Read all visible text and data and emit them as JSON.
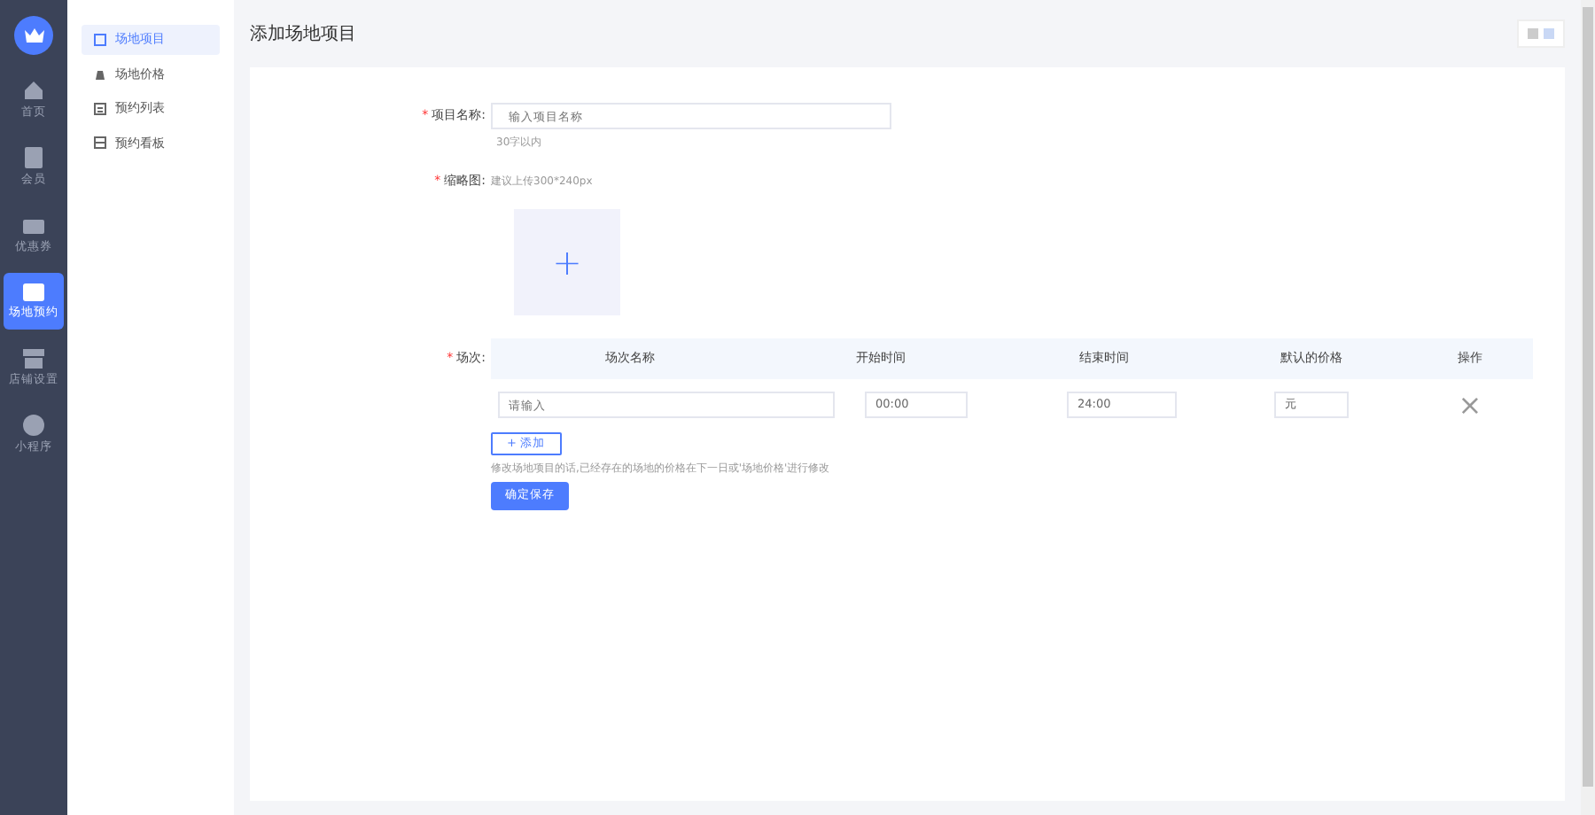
{
  "main_nav": [
    {
      "label": "首页",
      "selected": false
    },
    {
      "label": "会员",
      "selected": false
    },
    {
      "label": "优惠券",
      "selected": false
    },
    {
      "label": "场地预约",
      "selected": true
    },
    {
      "label": "店铺设置",
      "selected": false
    },
    {
      "label": "小程序",
      "selected": false
    }
  ],
  "sub_nav": [
    {
      "label": "场地项目",
      "selected": true
    },
    {
      "label": "场地价格",
      "selected": false
    },
    {
      "label": "预约列表",
      "selected": false
    },
    {
      "label": "预约看板",
      "selected": false
    }
  ],
  "page_title": "添加场地项目",
  "form": {
    "required_mark": [
      "*",
      "*",
      "*"
    ],
    "add_symbol": "+",
    "name_label": "项目名称:",
    "name_placeholder": "输入项目名称",
    "name_hint": "30字以内",
    "image_label": "缩略图:",
    "image_hint": "建议上传300*240px",
    "upload_symbol": "+",
    "sessions_label": "场次:",
    "columns": [
      "场次名称",
      "开始时间",
      "结束时间",
      "默认的价格",
      "操作"
    ],
    "rows": [
      {
        "name_placeholder": "请输入",
        "start": "00:00",
        "end": "24:00",
        "price_unit": "元",
        "delete_symbol": "×"
      }
    ],
    "add_button": "添加",
    "note": "修改场地项目的话,已经存在的场地的价格在下一日或'场地价格'进行修改",
    "submit": "确定保存"
  }
}
